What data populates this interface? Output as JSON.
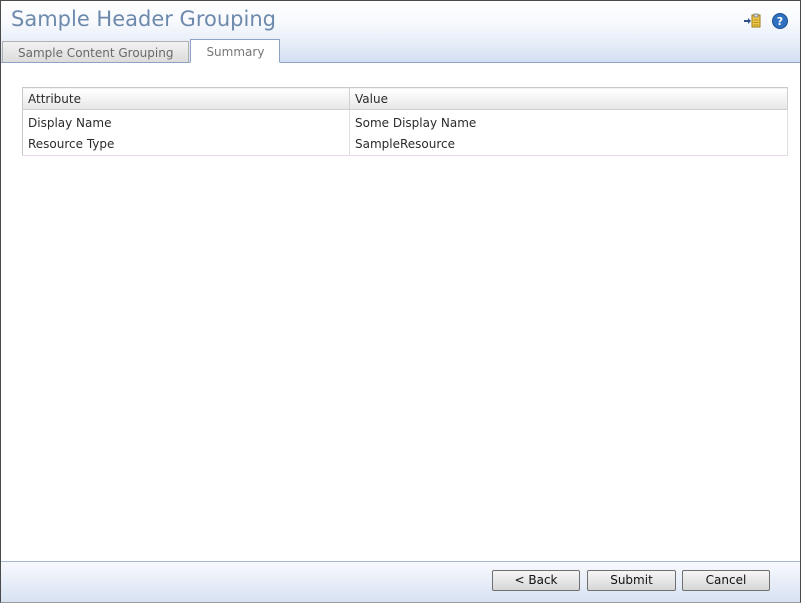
{
  "header": {
    "title": "Sample Header Grouping",
    "icons": [
      "export-icon",
      "help-icon"
    ]
  },
  "tabs": [
    {
      "label": "Sample Content Grouping",
      "active": false
    },
    {
      "label": "Summary",
      "active": true
    }
  ],
  "table": {
    "columns": [
      "Attribute",
      "Value"
    ],
    "rows": [
      [
        "Display Name",
        "Some Display Name"
      ],
      [
        "Resource Type",
        "SampleResource"
      ]
    ]
  },
  "footer": {
    "back_label": "< Back",
    "submit_label": "Submit",
    "cancel_label": "Cancel"
  },
  "colors": {
    "title": "#6d8aac",
    "header_gradient_end": "#d3dff2",
    "help_icon": "#2f6fc0"
  }
}
